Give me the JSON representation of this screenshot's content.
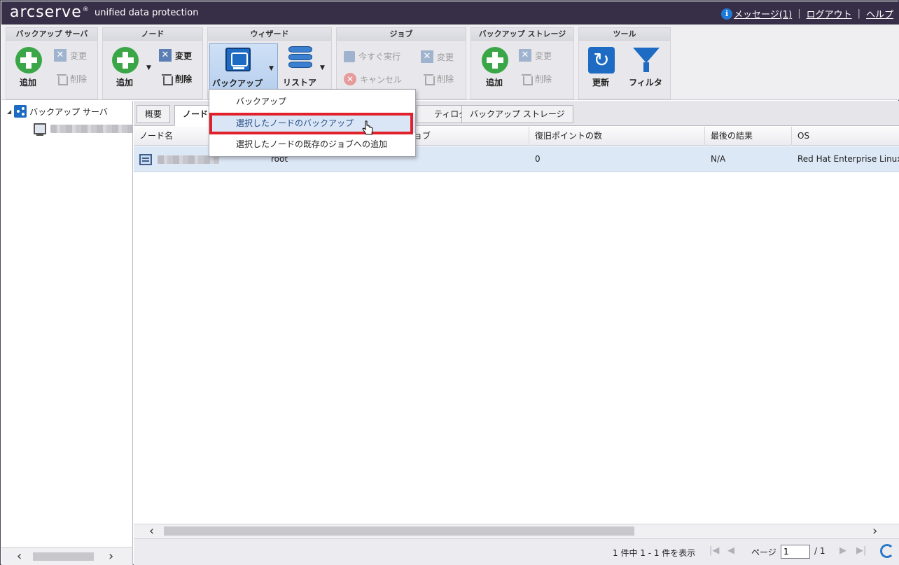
{
  "header": {
    "brand": "arcserve",
    "brand_mark": "®",
    "product": "unified data protection",
    "info_icon": "i",
    "messages": "メッセージ(1)",
    "logout": "ログアウト",
    "help": "ヘルプ",
    "separator": "|"
  },
  "ribbon": {
    "backup_server": {
      "title": "バックアップ サーバ",
      "add": "追加",
      "modify": "変更",
      "delete": "削除"
    },
    "node": {
      "title": "ノード",
      "add": "追加",
      "modify": "変更",
      "delete": "削除"
    },
    "wizard": {
      "title": "ウィザード",
      "backup": "バックアップ",
      "restore": "リストア"
    },
    "job": {
      "title": "ジョブ",
      "run_now": "今すぐ実行",
      "modify": "変更",
      "cancel": "キャンセル",
      "delete": "削除"
    },
    "backup_storage": {
      "title": "バックアップ ストレージ",
      "add": "追加",
      "modify": "変更",
      "delete": "削除"
    },
    "tools": {
      "title": "ツール",
      "refresh": "更新",
      "filter": "フィルタ"
    }
  },
  "tree": {
    "root_label": "バックアップ サーバ"
  },
  "tabs": [
    {
      "label": "概要"
    },
    {
      "label": "ノード"
    },
    {
      "label": "ティログ"
    },
    {
      "label": "バックアップ ストレージ"
    }
  ],
  "grid": {
    "columns": [
      "ノード名",
      "ョブ",
      "復旧ポイントの数",
      "最後の結果",
      "OS"
    ],
    "rows": [
      {
        "node": "",
        "user": "root",
        "recovery_points": "0",
        "last_result": "N/A",
        "os": "Red Hat Enterprise Linux"
      }
    ]
  },
  "pager": {
    "info": "1 件中 1 - 1 件を表示",
    "page_label": "ページ",
    "page_value": "1",
    "page_total": "/ 1"
  },
  "dropdown_menu": {
    "items": [
      {
        "label": "バックアップ"
      },
      {
        "label": "選択したノードのバックアップ"
      },
      {
        "label": "選択したノードの既存のジョブへの追加"
      }
    ],
    "selected_index": 1,
    "highlight_color": "#e0202a"
  }
}
